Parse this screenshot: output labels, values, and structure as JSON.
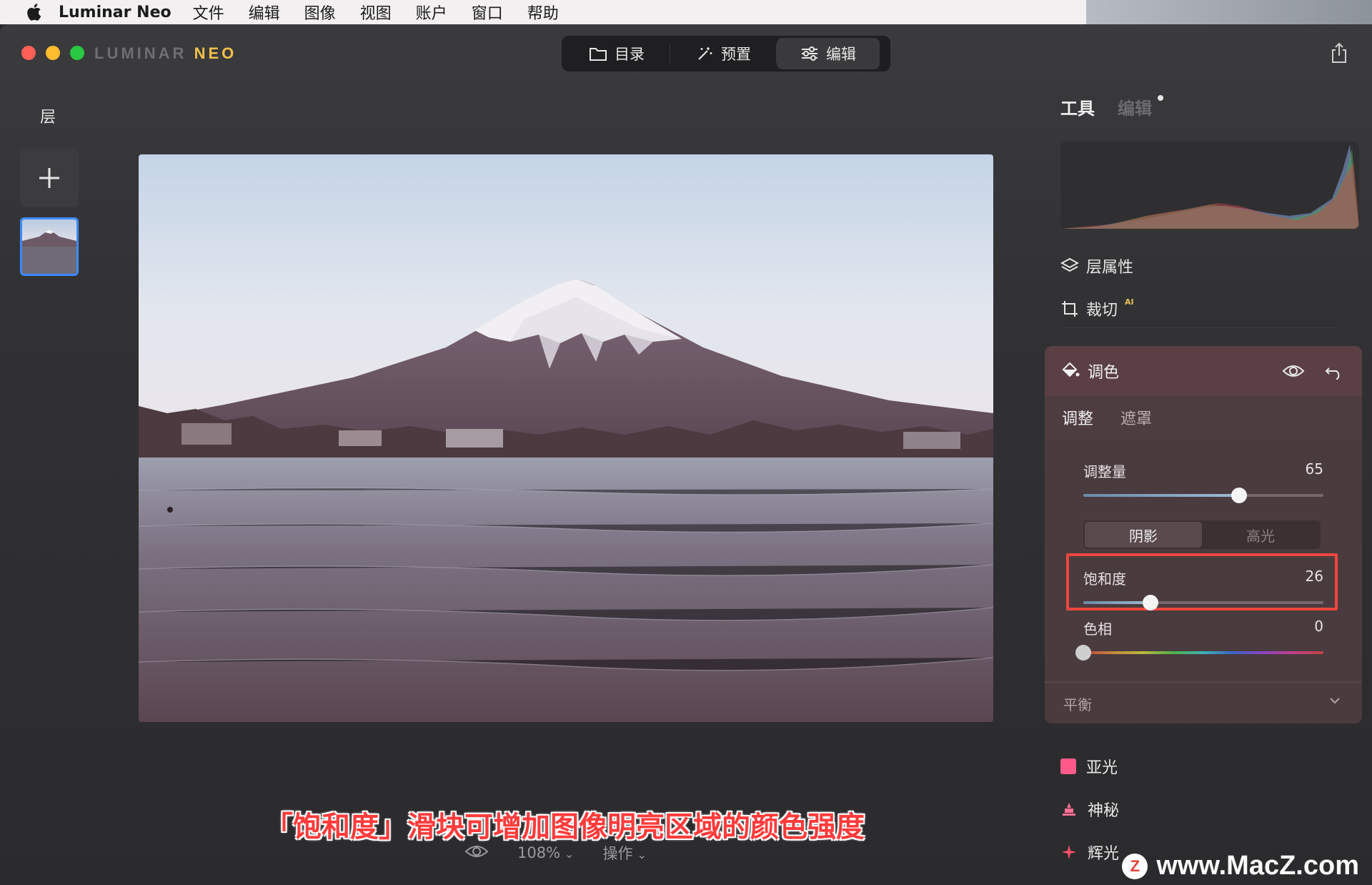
{
  "menubar": {
    "app_name": "Luminar Neo",
    "items": [
      "文件",
      "编辑",
      "图像",
      "视图",
      "账户",
      "窗口",
      "帮助"
    ]
  },
  "window": {
    "logo_left": "LUMINAR",
    "logo_right": "NEO",
    "modes": [
      {
        "label": "目录",
        "icon": "folder-icon"
      },
      {
        "label": "预置",
        "icon": "magic-wand-icon"
      },
      {
        "label": "编辑",
        "icon": "sliders-icon",
        "active": true
      }
    ]
  },
  "layers": {
    "title": "层"
  },
  "caption": "「饱和度」滑块可增加图像明亮区域的颜色强度",
  "bottom_bar": {
    "zoom": "108%",
    "actions": "操作"
  },
  "right_panel": {
    "tab_tools": "工具",
    "tab_edit": "编辑",
    "layer_props": "层属性",
    "crop": "裁切",
    "crop_badge": "AI",
    "tone": {
      "title": "调色",
      "tabs": [
        "调整",
        "遮罩"
      ],
      "amount_label": "调整量",
      "amount_value": "65",
      "segment": [
        "阴影",
        "高光"
      ],
      "saturation_label": "饱和度",
      "saturation_value": "26",
      "hue_label": "色相",
      "hue_value": "0",
      "balance_label": "平衡",
      "slider_levels": {
        "amount": 0.65,
        "saturation": 0.28,
        "hue": 0.0
      }
    },
    "tools_below": [
      {
        "label": "亚光",
        "icon": "matte-icon",
        "color": "#ff5a8a"
      },
      {
        "label": "神秘",
        "icon": "mystical-icon",
        "color": "#ff6f91"
      },
      {
        "label": "辉光",
        "icon": "sparkle-icon",
        "color": "#ff4f6b"
      }
    ]
  },
  "watermark": {
    "text": "www.MacZ.com",
    "logo_letter": "Z"
  },
  "colors": {
    "accent_blue": "#3c8bff",
    "highlight_red": "#f0463d",
    "tone_panel": "#4a3b3f"
  }
}
